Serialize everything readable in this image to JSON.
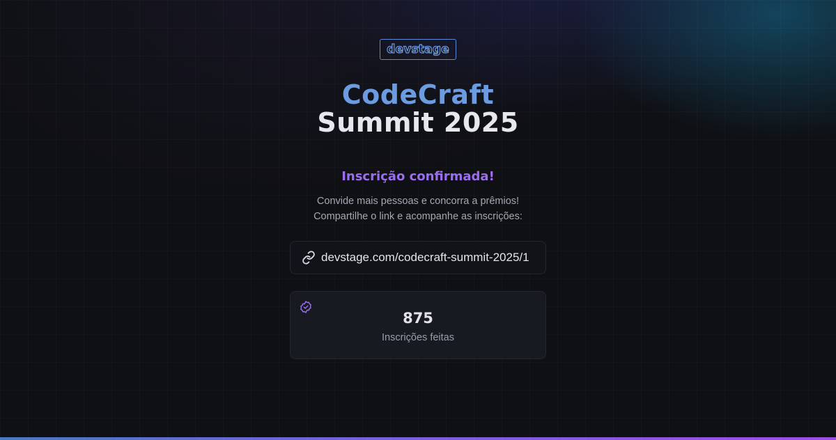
{
  "logo": {
    "text": "devstage"
  },
  "event": {
    "title_line1": "CodeCraft",
    "title_line2": "Summit 2025"
  },
  "status": {
    "heading": "Inscrição confirmada!"
  },
  "description": {
    "line1": "Convide mais pessoas e concorra a prêmios!",
    "line2": "Compartilhe o link e acompanhe as inscrições:"
  },
  "invite_link": {
    "icon": "link-icon",
    "text": "devstage.com/codecraft-summit-2025/1"
  },
  "stats": {
    "icon": "badge-check-icon",
    "value": "875",
    "label": "Inscrições feitas"
  },
  "colors": {
    "background": "#0f1014",
    "accent_blue": "#6b9be0",
    "accent_purple": "#9b6ef0",
    "card": "#171a21"
  }
}
